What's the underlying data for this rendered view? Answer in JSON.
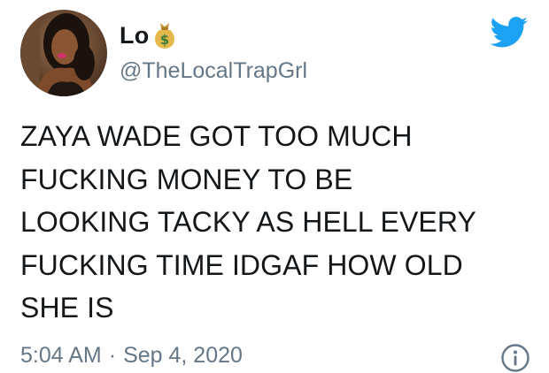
{
  "user": {
    "display_name": "Lo",
    "name_emoji": "money-bag-icon",
    "handle": "@TheLocalTrapGrl"
  },
  "tweet": {
    "lines": [
      "ZAYA WADE GOT TOO MUCH",
      "FUCKING MONEY TO BE",
      "LOOKING TACKY AS HELL EVERY",
      "FUCKING TIME IDGAF HOW OLD",
      "SHE IS"
    ]
  },
  "meta": {
    "time": "5:04 AM",
    "separator": "·",
    "date": "Sep 4, 2020"
  },
  "icons": {
    "brand": "twitter-bird-icon",
    "info": "info-icon"
  },
  "colors": {
    "twitter_blue": "#1da1f2",
    "text_primary": "#14171a",
    "text_secondary": "#657786"
  }
}
